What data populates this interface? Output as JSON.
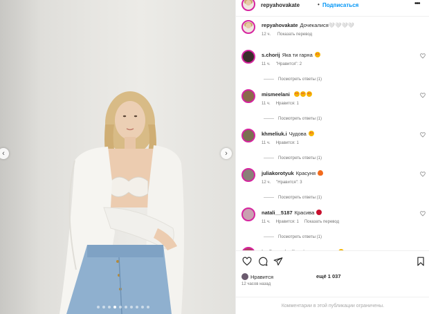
{
  "post": {
    "username": "repyahovakate",
    "separator": "•",
    "follow_label": "Подписаться",
    "more_icon": "more-icon",
    "caption_text": "Дочекалися🤍🤍🤍🤍",
    "caption_time": "12 ч.",
    "caption_translate": "Показать перевод"
  },
  "carousel": {
    "total": 10,
    "active_index": 3
  },
  "comments": [
    {
      "user": "s.chorij",
      "text": "Яка ти гарна",
      "emoji": "heart-eyes",
      "time": "11 ч.",
      "likes": "\"Нравится\": 2",
      "translate": "",
      "replies": "Посмотреть ответы (1)",
      "avatar_color": "#3a2e2a"
    },
    {
      "user": "mismeelani",
      "text": "",
      "emoji": "heart-eyes-x3",
      "time": "11 ч.",
      "likes": "Нравится: 1",
      "translate": "",
      "replies": "Посмотреть ответы (1)",
      "avatar_color": "#8a6a4a"
    },
    {
      "user": "khmeliuk.i",
      "text": "Чудова",
      "emoji": "heart-eyes",
      "time": "11 ч.",
      "likes": "Нравится: 1",
      "translate": "",
      "replies": "Посмотреть ответы (1)",
      "avatar_color": "#7a7050"
    },
    {
      "user": "juliakorotyuk",
      "text": "Красуня",
      "emoji": "fire",
      "time": "12 ч.",
      "likes": "\"Нравится\": 3",
      "translate": "",
      "replies": "Посмотреть ответы (1)",
      "avatar_color": "#8a8078"
    },
    {
      "user": "natali__5187",
      "text": "Красива",
      "emoji": "rose",
      "time": "11 ч.",
      "likes": "Нравится: 1",
      "translate": "Показать перевод",
      "replies": "Посмотреть ответы (1)",
      "avatar_color": "#c9a0b0"
    },
    {
      "user": "la_fleur_de_lis",
      "text": "Дівчинка-весна",
      "emoji": "heart-eyes",
      "time": "",
      "likes": "",
      "translate": "",
      "replies": "",
      "avatar_color": "#b04060"
    }
  ],
  "actions": {
    "like_icon": "heart-icon",
    "comment_icon": "comment-icon",
    "share_icon": "share-icon",
    "save_icon": "bookmark-icon",
    "liked_by_user": "Нравится",
    "liked_by_more": "ещё 1 037",
    "time_ago": "12 часов назад",
    "comments_limited": "Комментарии в этой публикации ограничены."
  }
}
